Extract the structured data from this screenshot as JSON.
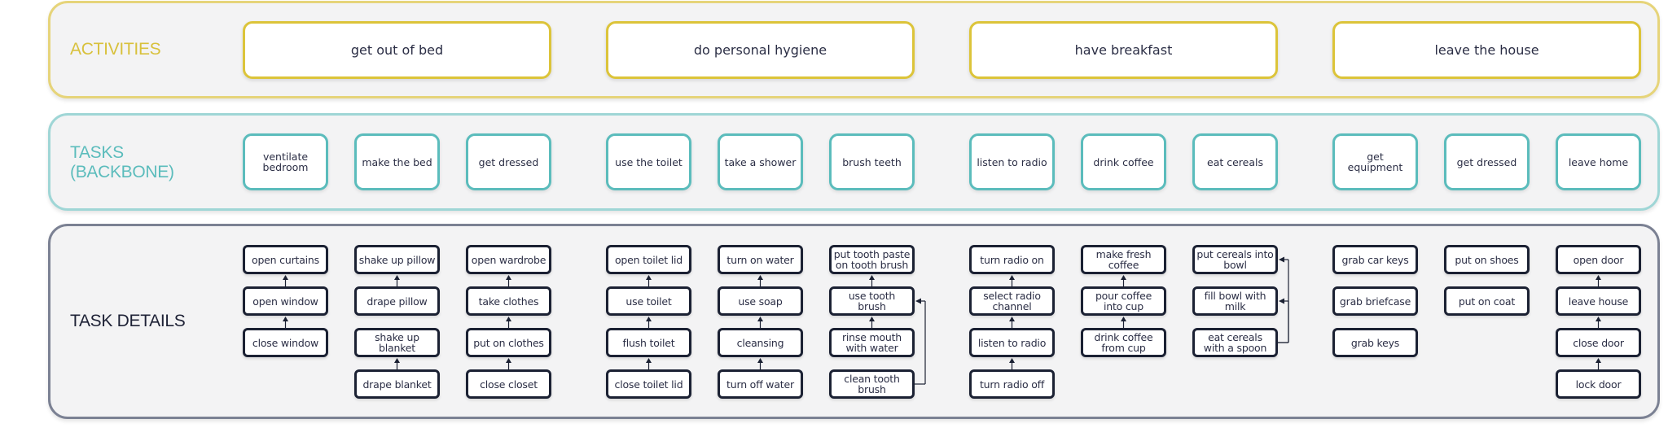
{
  "rows": {
    "activities_label": "ACTIVITIES",
    "tasks_label": "TASKS\n(BACKBONE)",
    "details_label": "TASK DETAILS"
  },
  "colors": {
    "activities": "#dcc43a",
    "tasks": "#5bbcbc",
    "details": "#1b2133"
  },
  "activities": [
    {
      "label": "get out of bed",
      "tasks": [
        {
          "label": "ventilate bedroom",
          "details": [
            "open curtains",
            "open window",
            "close window"
          ]
        },
        {
          "label": "make the bed",
          "details": [
            "shake up pillow",
            "drape pillow",
            "shake up blanket",
            "drape blanket"
          ]
        },
        {
          "label": "get dressed",
          "details": [
            "open wardrobe",
            "take clothes",
            "put on clothes",
            "close closet"
          ]
        }
      ]
    },
    {
      "label": "do personal hygiene",
      "tasks": [
        {
          "label": "use the toilet",
          "details": [
            "open toilet lid",
            "use toilet",
            "flush toilet",
            "close toilet lid"
          ]
        },
        {
          "label": "take a shower",
          "details": [
            "turn on water",
            "use soap",
            "cleansing",
            "turn off water"
          ]
        },
        {
          "label": "brush teeth",
          "details": [
            "put tooth paste on tooth brush",
            "use tooth brush",
            "rinse mouth with water",
            "clean tooth brush"
          ]
        }
      ]
    },
    {
      "label": "have breakfast",
      "tasks": [
        {
          "label": "listen to radio",
          "details": [
            "turn radio on",
            "select radio channel",
            "listen to radio",
            "turn radio off"
          ]
        },
        {
          "label": "drink coffee",
          "details": [
            "make fresh coffee",
            "pour coffee into cup",
            "drink coffee from cup"
          ]
        },
        {
          "label": "eat cereals",
          "details": [
            "put cereals into bowl",
            "fill bowl with milk",
            "eat cereals with a spoon"
          ]
        }
      ]
    },
    {
      "label": "leave the house",
      "tasks": [
        {
          "label": "get equipment",
          "details": [
            "grab car keys",
            "grab briefcase",
            "grab keys"
          ]
        },
        {
          "label": "get dressed",
          "details": [
            "put on shoes",
            "put on coat"
          ]
        },
        {
          "label": "leave home",
          "details": [
            "open door",
            "leave house",
            "close door",
            "lock door"
          ]
        }
      ]
    }
  ],
  "connections": [
    {
      "from": "close window",
      "to": "open window"
    },
    {
      "from": "open window",
      "to": "open curtains"
    },
    {
      "from": "drape pillow",
      "to": "shake up pillow"
    },
    {
      "from": "drape blanket",
      "to": "shake up blanket"
    },
    {
      "from": "take clothes",
      "to": "open wardrobe"
    },
    {
      "from": "put on clothes",
      "to": "take clothes"
    },
    {
      "from": "close closet",
      "to": "put on clothes"
    },
    {
      "from": "use toilet",
      "to": "open toilet lid"
    },
    {
      "from": "flush toilet",
      "to": "use toilet"
    },
    {
      "from": "close toilet lid",
      "to": "flush toilet"
    },
    {
      "from": "use soap",
      "to": "turn on water"
    },
    {
      "from": "cleansing",
      "to": "use soap"
    },
    {
      "from": "turn off water",
      "to": "cleansing"
    },
    {
      "from": "use tooth brush",
      "to": "put tooth paste on tooth brush"
    },
    {
      "from": "rinse mouth with water",
      "to": "use tooth brush"
    },
    {
      "from": "clean tooth brush",
      "to": "use tooth brush",
      "loop": true
    },
    {
      "from": "select radio channel",
      "to": "turn radio on"
    },
    {
      "from": "listen to radio",
      "to": "select radio channel"
    },
    {
      "from": "turn radio off",
      "to": "listen to radio"
    },
    {
      "from": "pour coffee into cup",
      "to": "make fresh coffee"
    },
    {
      "from": "drink coffee from cup",
      "to": "pour coffee into cup"
    },
    {
      "from": "eat cereals with a spoon",
      "to": "fill bowl with milk",
      "loop": true
    },
    {
      "from": "eat cereals with a spoon",
      "to": "put cereals into bowl",
      "loop": true
    },
    {
      "from": "leave house",
      "to": "open door"
    },
    {
      "from": "close door",
      "to": "leave house"
    },
    {
      "from": "lock door",
      "to": "close door"
    }
  ]
}
